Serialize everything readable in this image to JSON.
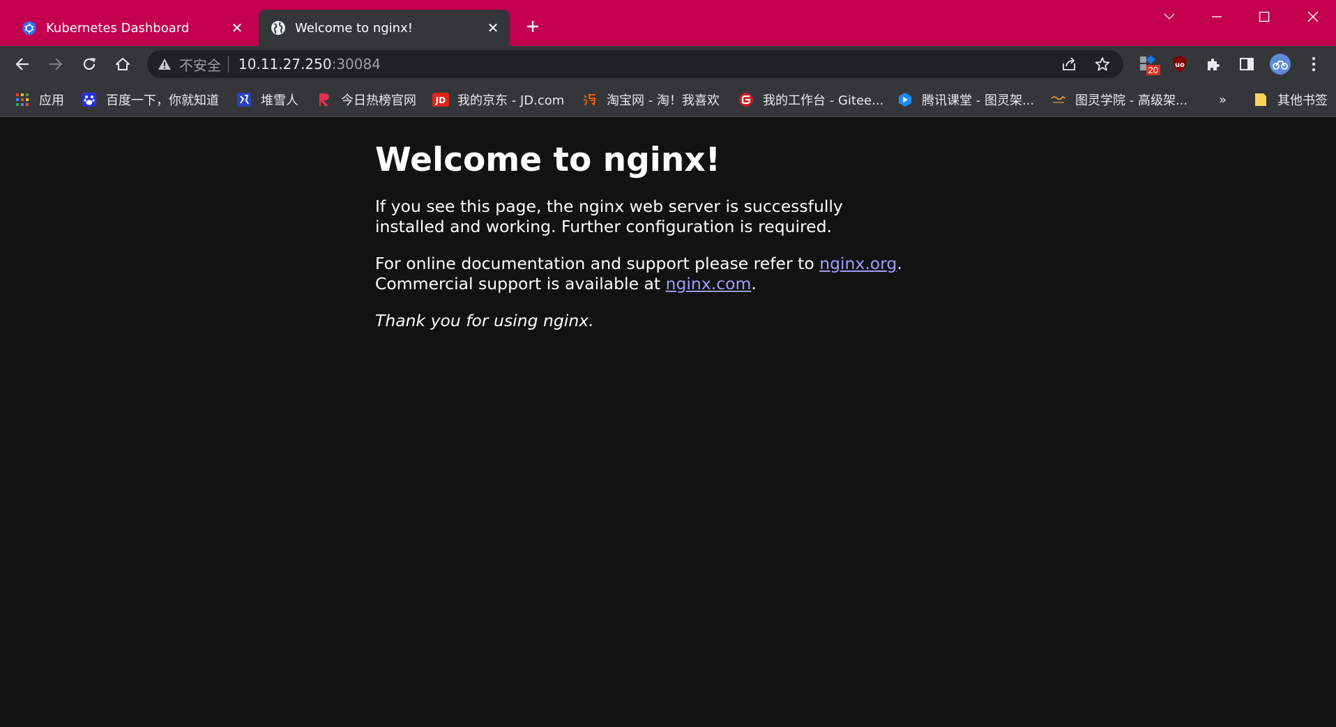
{
  "tabs": [
    {
      "title": "Kubernetes Dashboard",
      "active": false,
      "icon": "kubernetes-icon"
    },
    {
      "title": "Welcome to nginx!",
      "active": true,
      "icon": "globe-icon"
    }
  ],
  "address_bar": {
    "security_label": "不安全",
    "host": "10.11.27.250",
    "port": ":30084"
  },
  "extensions": {
    "badge_count": "20"
  },
  "bookmarks": [
    {
      "label": "应用",
      "icon": "apps-grid-icon"
    },
    {
      "label": "百度一下，你就知道",
      "icon": "baidu-icon"
    },
    {
      "label": "堆雪人",
      "icon": "duixueren-icon"
    },
    {
      "label": "今日热榜官网",
      "icon": "tophub-icon"
    },
    {
      "label": "我的京东 - JD.com",
      "icon": "jd-icon"
    },
    {
      "label": "淘宝网 - 淘！我喜欢",
      "icon": "taobao-icon"
    },
    {
      "label": "我的工作台 - Gitee...",
      "icon": "gitee-icon"
    },
    {
      "label": "腾讯课堂 - 图灵架...",
      "icon": "tencent-classroom-icon"
    },
    {
      "label": "图灵学院 - 高级架...",
      "icon": "tuling-icon"
    }
  ],
  "bookmarks_overflow": "»",
  "other_bookmarks": "其他书签",
  "page": {
    "heading": "Welcome to nginx!",
    "p1": "If you see this page, the nginx web server is successfully installed and working. Further configuration is required.",
    "p2_prefix": "For online documentation and support please refer to ",
    "link_org": "nginx.org",
    "p2_mid": ".",
    "p2_line2": "Commercial support is available at ",
    "link_com": "nginx.com",
    "p2_end": ".",
    "p3": "Thank you for using nginx."
  },
  "colors": {
    "frame": "#c2004f",
    "toolbar": "#35363a",
    "page_bg": "#121212",
    "link": "#9e9eff"
  }
}
